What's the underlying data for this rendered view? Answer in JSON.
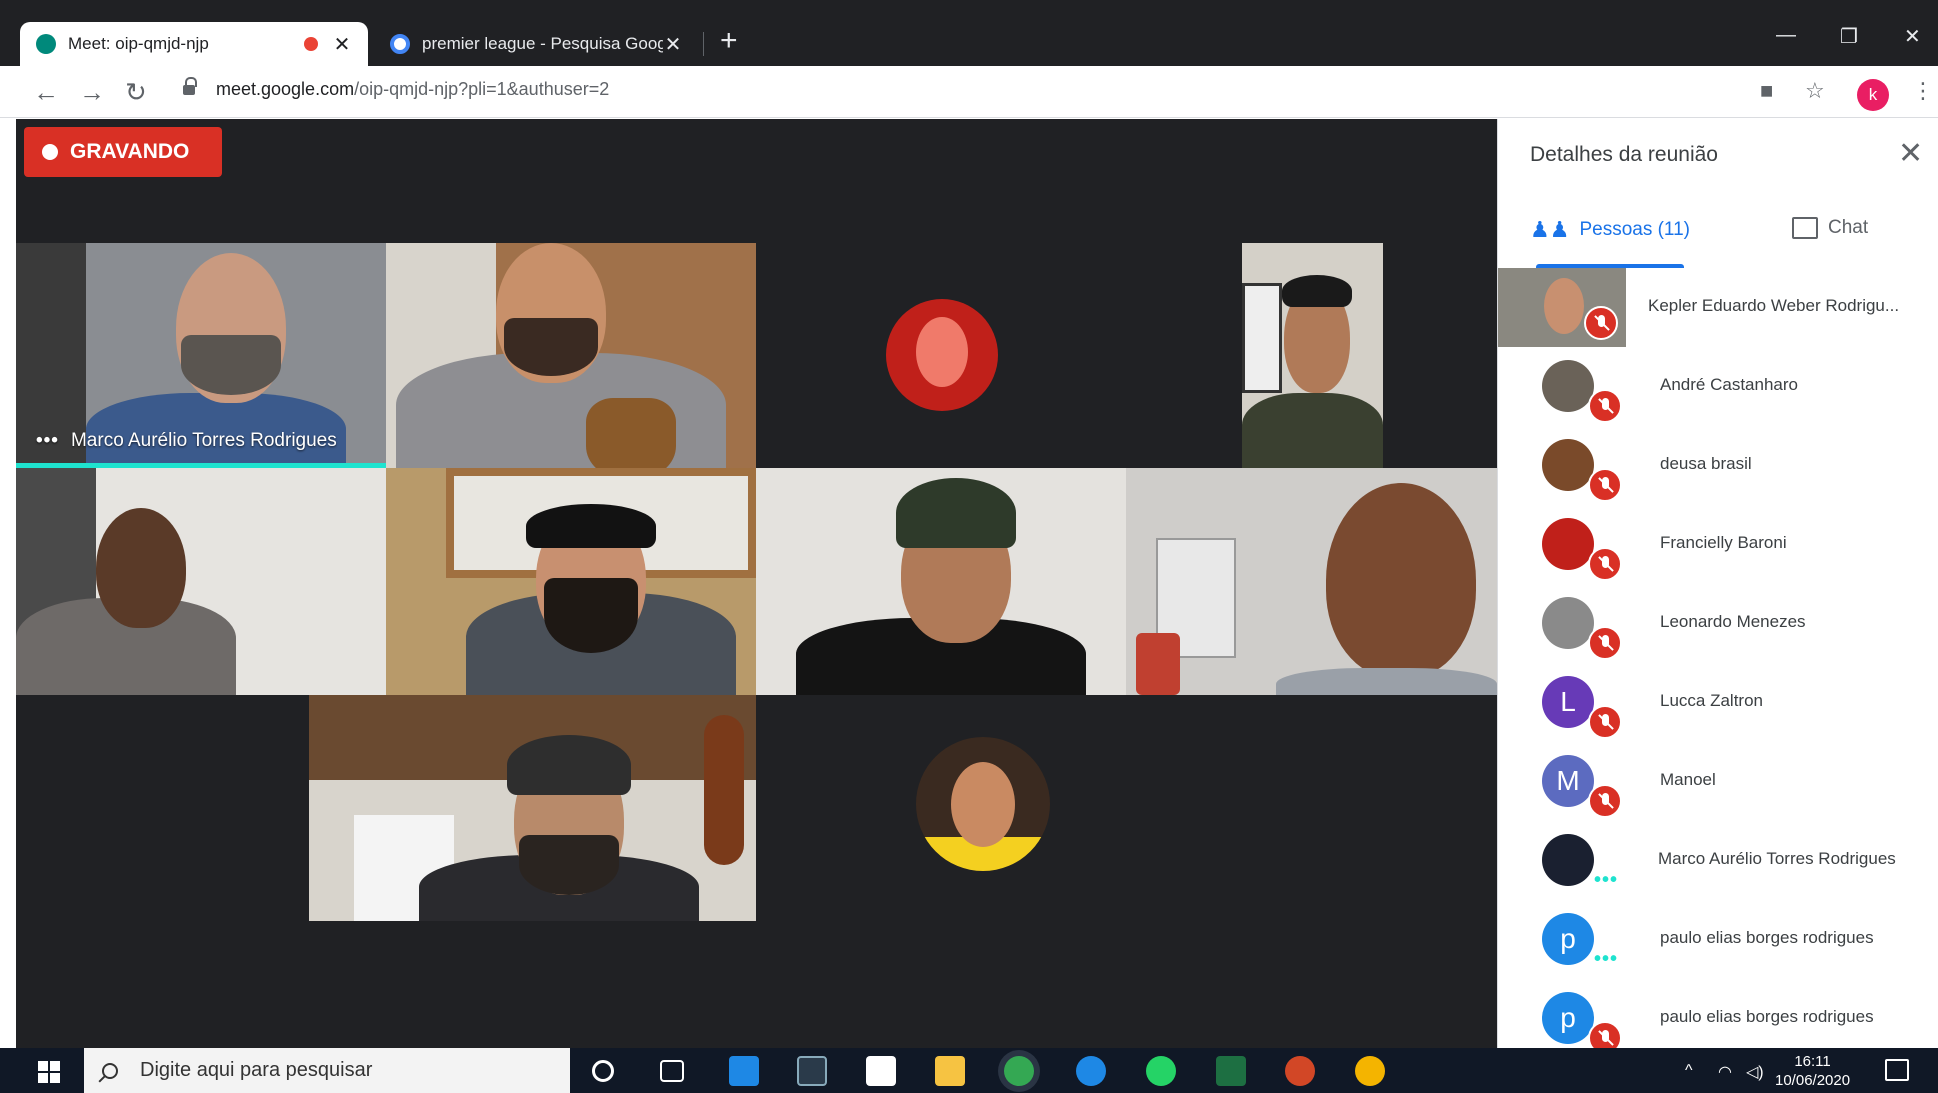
{
  "browser": {
    "tabs": [
      {
        "title": "Meet: oip-qmjd-njp",
        "active": true,
        "recording": true
      },
      {
        "title": "premier league - Pesquisa Googl",
        "active": false
      }
    ],
    "new_tab": "+",
    "url_host": "meet.google.com",
    "url_path": "/oip-qmjd-njp?pli=1&authuser=2",
    "profile_initial": "k"
  },
  "meet": {
    "recording_label": "GRAVANDO",
    "active_speaker_name": "Marco Aurélio Torres Rodrigues"
  },
  "panel": {
    "title": "Detalhes da reunião",
    "tab_people": "Pessoas (11)",
    "tab_chat": "Chat",
    "participants": [
      {
        "name": "Kepler Eduardo Weber Rodrigu...",
        "muted": true,
        "initial": ""
      },
      {
        "name": "André Castanharo",
        "muted": true,
        "initial": ""
      },
      {
        "name": "deusa brasil",
        "muted": true,
        "initial": ""
      },
      {
        "name": "Francielly Baroni",
        "muted": true,
        "initial": ""
      },
      {
        "name": "Leonardo Menezes",
        "muted": true,
        "initial": ""
      },
      {
        "name": "Lucca Zaltron",
        "muted": true,
        "initial": "L"
      },
      {
        "name": "Manoel",
        "muted": true,
        "initial": "M"
      },
      {
        "name": "Marco Aurélio Torres Rodrigues",
        "muted": false,
        "initial": ""
      },
      {
        "name": "paulo elias borges rodrigues",
        "muted": false,
        "initial": "p"
      },
      {
        "name": "paulo elias borges rodrigues",
        "muted": true,
        "initial": "p"
      }
    ]
  },
  "taskbar": {
    "search_placeholder": "Digite aqui para pesquisar",
    "time": "16:11",
    "date": "10/06/2020"
  },
  "colors": {
    "accent": "#1a73e8",
    "recording": "#d93025",
    "stage": "#202124",
    "speaking": "#1ee3cf"
  }
}
